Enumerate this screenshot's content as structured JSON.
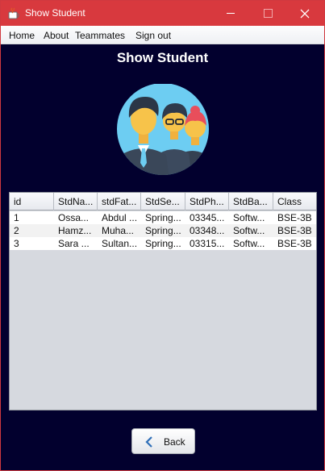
{
  "window": {
    "title": "Show Student",
    "title_bar_color": "#d8393e",
    "background_color": "#02002e",
    "controls": [
      "minimize-icon",
      "maximize-icon",
      "close-icon"
    ]
  },
  "menu": {
    "items": [
      "Home",
      "About",
      "Teammates",
      "Sign out"
    ]
  },
  "page": {
    "heading": "Show Student",
    "image": "students-group-avatar"
  },
  "table": {
    "columns": [
      "id",
      "StdNa...",
      "stdFat...",
      "StdSe...",
      "StdPh...",
      "StdBa...",
      "Class"
    ],
    "rows": [
      [
        "1",
        "Ossa...",
        "Abdul ...",
        "Spring...",
        "03345...",
        "Softw...",
        "BSE-3B"
      ],
      [
        "2",
        "Hamz...",
        "Muha...",
        "Spring...",
        "03348...",
        "Softw...",
        "BSE-3B"
      ],
      [
        "3",
        "Sara ...",
        "Sultan...",
        "Spring...",
        "03315...",
        "Softw...",
        "BSE-3B"
      ]
    ]
  },
  "actions": {
    "back_label": "Back",
    "back_icon": "chevron-left-icon"
  }
}
